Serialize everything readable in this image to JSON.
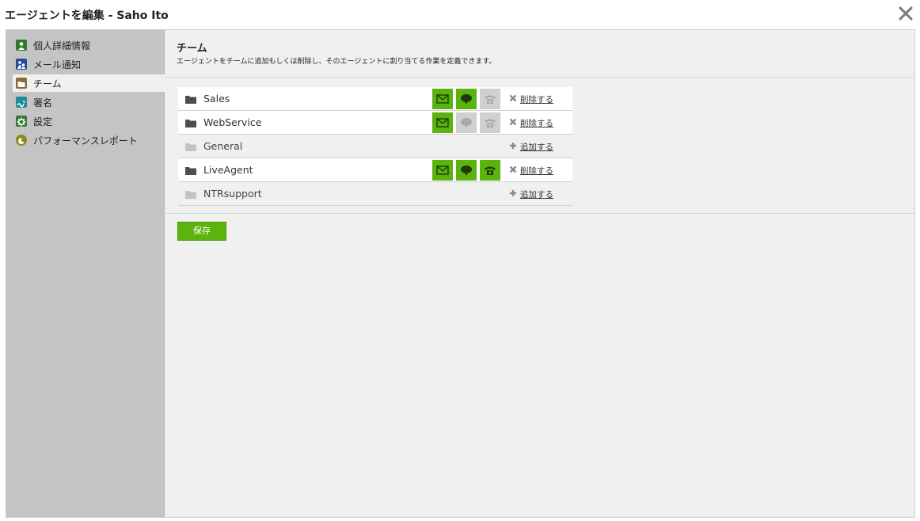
{
  "window": {
    "title": "エージェントを編集 - Saho Ito"
  },
  "sidebar": {
    "items": [
      {
        "label": "個人詳細情報",
        "icon": "person-icon",
        "color": "#2f7a2f"
      },
      {
        "label": "メール通知",
        "icon": "mail-notify-icon",
        "color": "#2a4a99"
      },
      {
        "label": "チーム",
        "icon": "team-folder-icon",
        "color": "#8a6a35",
        "active": true
      },
      {
        "label": "署名",
        "icon": "signature-icon",
        "color": "#1e8a9a"
      },
      {
        "label": "設定",
        "icon": "gear-icon",
        "color": "#2f7a2f"
      },
      {
        "label": "パフォーマンスレポート",
        "icon": "chart-icon",
        "color": "#8a8a1a"
      }
    ]
  },
  "header": {
    "title": "チーム",
    "description": "エージェントをチームに追加もしくは削除し、そのエージェントに割り当てる作業を定義できます。"
  },
  "teams": [
    {
      "name": "Sales",
      "member": true,
      "email": true,
      "chat": true,
      "call": false,
      "action": "削除する"
    },
    {
      "name": "WebService",
      "member": true,
      "email": true,
      "chat": false,
      "call": false,
      "action": "削除する"
    },
    {
      "name": "General",
      "member": false,
      "action": "追加する"
    },
    {
      "name": "LiveAgent",
      "member": true,
      "email": true,
      "chat": true,
      "call": true,
      "action": "削除する"
    },
    {
      "name": "NTRsupport",
      "member": false,
      "action": "追加する"
    }
  ],
  "actions": {
    "save_label": "保存"
  },
  "colors": {
    "accent": "#5bb40d",
    "sidebar": "#c4c4c4",
    "panel": "#f0f0f0",
    "channel_off": "#d0d0d0"
  }
}
